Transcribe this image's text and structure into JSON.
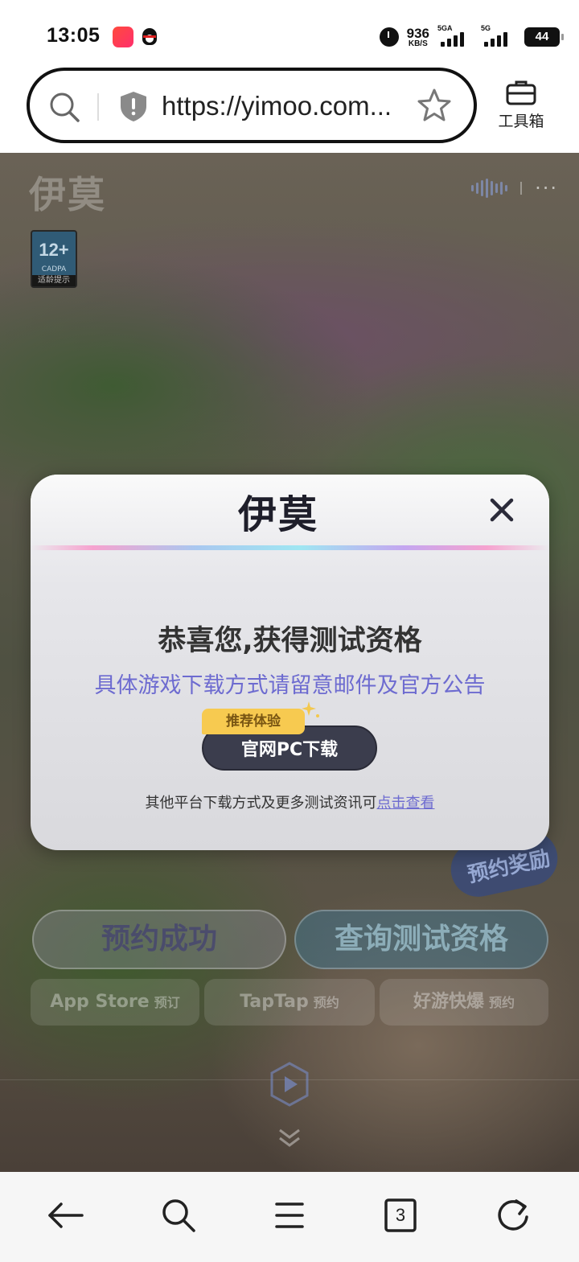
{
  "status_bar": {
    "time": "13:05",
    "net_speed": "936",
    "net_unit": "KB/S",
    "sim1": "5GA",
    "sim2": "5G",
    "battery": "44"
  },
  "browser": {
    "url": "https://yimoo.com...",
    "toolbox_label": "工具箱",
    "tabs_count": "3"
  },
  "page": {
    "logo": "伊莫",
    "age_rating": "12+",
    "age_org": "CADPA",
    "age_note": "适龄提示",
    "reward_badge": "预约奖励",
    "reserved_label": "预约成功",
    "query_label": "查询测试资格",
    "stores": [
      {
        "name": "App Store",
        "action": "预订"
      },
      {
        "name": "TapTap",
        "action": "预约"
      },
      {
        "name": "好游快爆",
        "action": "预约"
      }
    ]
  },
  "modal": {
    "logo": "伊莫",
    "title": "恭喜您,获得测试资格",
    "subtitle": "具体游戏下载方式请留意邮件及官方公告",
    "recommend_tag": "推荐体验",
    "download_label": "官网PC下载",
    "footer_text": "其他平台下载方式及更多测试资讯可",
    "footer_link": "点击查看"
  },
  "colors": {
    "accent_purple": "#6d6bd0",
    "button_dark": "#3b3d4d",
    "tag_yellow": "#f7ca50"
  }
}
